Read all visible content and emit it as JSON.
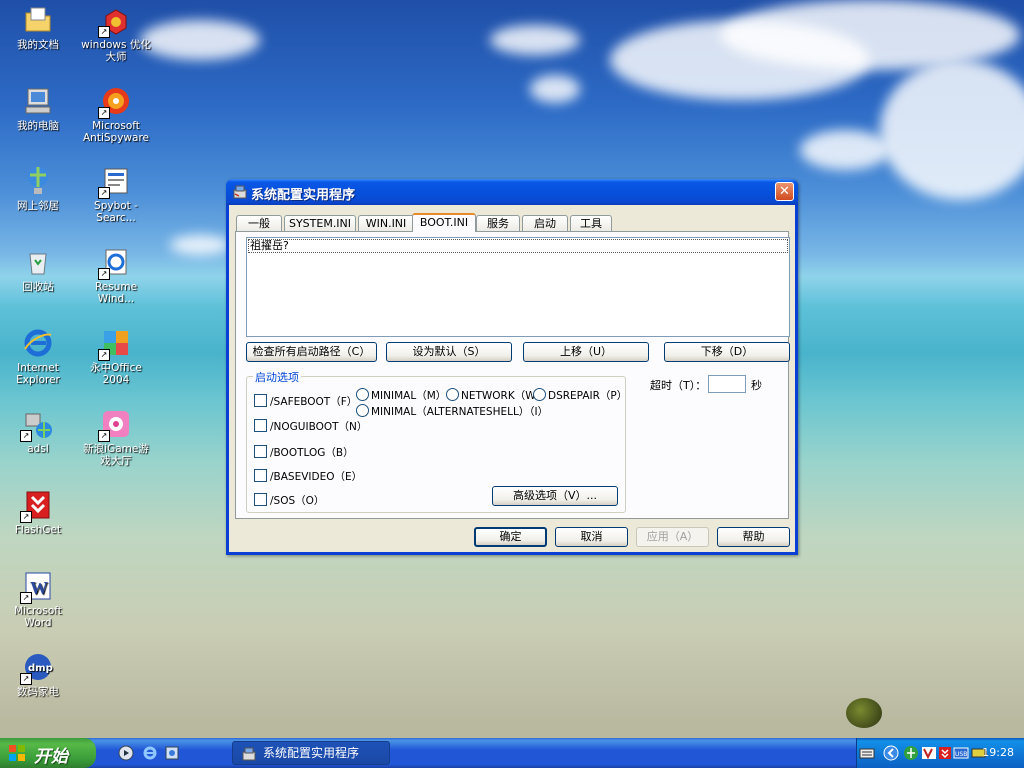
{
  "desktop": {
    "icons": [
      {
        "label": "我的文档"
      },
      {
        "label": "windows 优化大师"
      },
      {
        "label": "我的电脑"
      },
      {
        "label": "Microsoft AntiSpyware"
      },
      {
        "label": "网上邻居"
      },
      {
        "label": "Spybot - Searc..."
      },
      {
        "label": "回收站"
      },
      {
        "label": "Resume Wind..."
      },
      {
        "label": "Internet Explorer"
      },
      {
        "label": "永中Office 2004"
      },
      {
        "label": "adsl"
      },
      {
        "label": "新浪iGame游戏大厅"
      },
      {
        "label": "FlashGet"
      },
      {
        "label": "Microsoft Word"
      },
      {
        "label": "数码家电"
      }
    ]
  },
  "window": {
    "title": "系统配置实用程序",
    "close_symbol": "✕",
    "tabs": [
      {
        "label": "一般"
      },
      {
        "label": "SYSTEM.INI"
      },
      {
        "label": "WIN.INI"
      },
      {
        "label": "BOOT.INI"
      },
      {
        "label": "服务"
      },
      {
        "label": "启动"
      },
      {
        "label": "工具"
      }
    ],
    "active_tab": "BOOT.INI",
    "boot_list": {
      "lines": [
        "祖擢岳?"
      ]
    },
    "buttons": {
      "check_paths": "检查所有启动路径（C）",
      "set_default": "设为默认（S）",
      "move_up": "上移（U）",
      "move_down": "下移（D）",
      "advanced": "高级选项（V）..."
    },
    "boot_options": {
      "legend": "启动选项",
      "checkboxes": [
        {
          "label": "/SAFEBOOT（F）",
          "checked": false
        },
        {
          "label": "/NOGUIBOOT（N）",
          "checked": false
        },
        {
          "label": "/BOOTLOG（B）",
          "checked": false
        },
        {
          "label": "/BASEVIDEO（E）",
          "checked": false
        },
        {
          "label": "/SOS（O）",
          "checked": false
        }
      ],
      "radios": [
        {
          "label": "MINIMAL（M）",
          "selected": false
        },
        {
          "label": "NETWORK（W）",
          "selected": false
        },
        {
          "label": "DSREPAIR（P）",
          "selected": false
        },
        {
          "label": "MINIMAL（ALTERNATESHELL）（I）",
          "selected": false
        }
      ]
    },
    "timeout": {
      "label": "超时（T）：",
      "value": "",
      "unit": "秒"
    },
    "footer": {
      "ok": "确定",
      "cancel": "取消",
      "apply": "应用（A）",
      "help": "帮助"
    }
  },
  "taskbar": {
    "start_label": "开始",
    "task_label": "系统配置实用程序",
    "clock": "19:28",
    "tray_icons": [
      "keyboard-icon",
      "arrow-left-icon",
      "network-icon",
      "antispyware-icon",
      "flashget-icon",
      "usb-icon",
      "battery-icon"
    ]
  },
  "colors": {
    "titlebar_blue": "#0a58e8",
    "taskbar_blue": "#2157d7",
    "start_green": "#3a9e3a",
    "dialog_face": "#ece9d8",
    "groupbox_legend": "#0046d5"
  }
}
